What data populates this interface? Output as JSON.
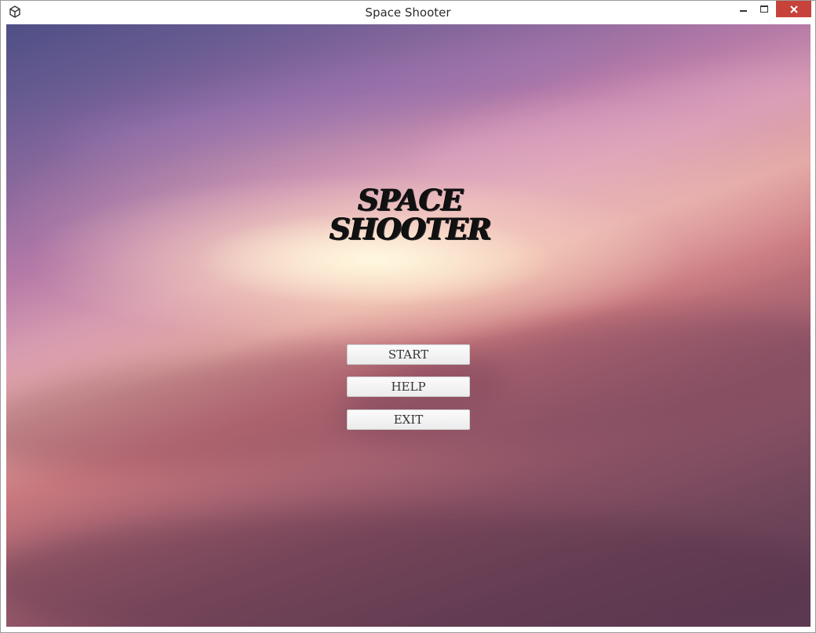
{
  "window": {
    "title": "Space Shooter",
    "controls": {
      "minimize_icon": "minimize-icon",
      "maximize_icon": "maximize-icon",
      "close_icon": "close-icon",
      "close_color": "#c7423a"
    },
    "app_icon": "unity-logo-icon"
  },
  "game": {
    "logo": {
      "line1": "SPACE",
      "line2": "SHOOTER"
    },
    "menu": {
      "start_label": "START",
      "help_label": "HELP",
      "exit_label": "EXIT"
    },
    "background": "nebula-space-image"
  }
}
